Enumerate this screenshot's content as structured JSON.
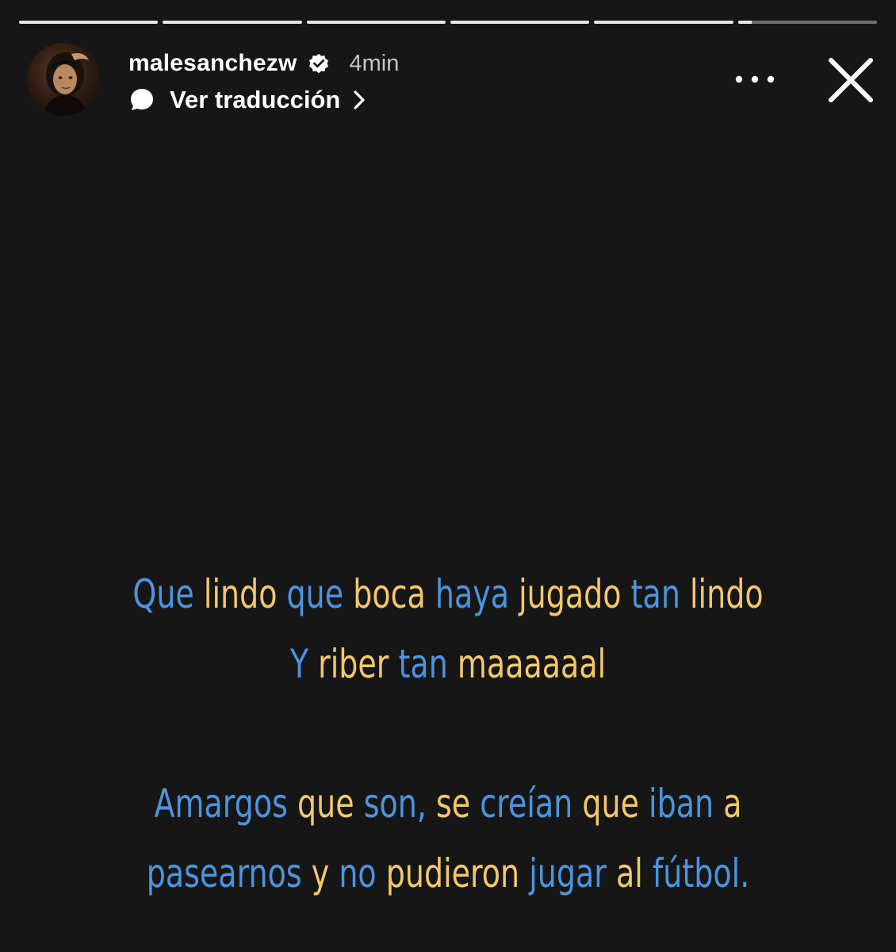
{
  "progress": [
    1,
    1,
    1,
    1,
    1,
    0.1
  ],
  "header": {
    "username": "malesanchezw",
    "time": "4min",
    "translate_label": "Ver traducción"
  },
  "colors": {
    "background": "#161616",
    "blue": "#4c94df",
    "yellow": "#f3c86c"
  },
  "story": {
    "line1": [
      {
        "text": "Que",
        "color": "blue"
      },
      {
        "text": "lindo",
        "color": "yellow"
      },
      {
        "text": "que",
        "color": "blue"
      },
      {
        "text": "boca",
        "color": "yellow"
      },
      {
        "text": "haya",
        "color": "blue"
      },
      {
        "text": "jugado",
        "color": "yellow"
      },
      {
        "text": "tan",
        "color": "blue"
      },
      {
        "text": "lindo",
        "color": "yellow"
      }
    ],
    "line2": [
      {
        "text": "Y",
        "color": "blue"
      },
      {
        "text": "riber",
        "color": "yellow"
      },
      {
        "text": "tan",
        "color": "blue"
      },
      {
        "text": "maaaaaal",
        "color": "yellow"
      }
    ],
    "line3": [
      {
        "text": "Amargos",
        "color": "blue"
      },
      {
        "text": "que",
        "color": "yellow"
      },
      {
        "text": "son,",
        "color": "blue"
      },
      {
        "text": "se",
        "color": "yellow"
      },
      {
        "text": "creían",
        "color": "blue"
      },
      {
        "text": "que",
        "color": "yellow"
      },
      {
        "text": "iban",
        "color": "blue"
      },
      {
        "text": "a",
        "color": "yellow"
      }
    ],
    "line4": [
      {
        "text": "pasearnos",
        "color": "blue"
      },
      {
        "text": "y",
        "color": "yellow"
      },
      {
        "text": "no",
        "color": "blue"
      },
      {
        "text": "pudieron",
        "color": "yellow"
      },
      {
        "text": "jugar",
        "color": "blue"
      },
      {
        "text": "al",
        "color": "yellow"
      },
      {
        "text": "fútbol.",
        "color": "blue"
      }
    ]
  }
}
